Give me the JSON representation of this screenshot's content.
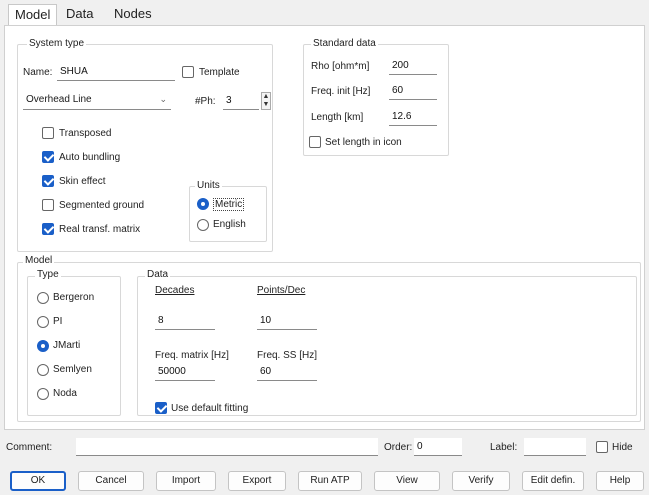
{
  "tabs": [
    "Model",
    "Data",
    "Nodes"
  ],
  "system_type": {
    "label": "System type",
    "name_label": "Name:",
    "name_value": "SHUA",
    "template_label": "Template",
    "template_checked": false,
    "line_type": "Overhead Line",
    "nph_label": "#Ph:",
    "nph_value": "3",
    "checkboxes": [
      {
        "label": "Transposed",
        "checked": false
      },
      {
        "label": "Auto bundling",
        "checked": true
      },
      {
        "label": "Skin effect",
        "checked": true
      },
      {
        "label": "Segmented ground",
        "checked": false
      },
      {
        "label": "Real transf. matrix",
        "checked": true
      }
    ],
    "units": {
      "label": "Units",
      "options": [
        "Metric",
        "English"
      ],
      "selected": "Metric"
    }
  },
  "standard_data": {
    "label": "Standard data",
    "rho_label": "Rho [ohm*m]",
    "rho_value": "200",
    "freq_label": "Freq. init [Hz]",
    "freq_value": "60",
    "length_label": "Length [km]",
    "length_value": "12.6",
    "set_length_label": "Set length in icon",
    "set_length_checked": false
  },
  "model": {
    "label": "Model",
    "type_label": "Type",
    "types": [
      "Bergeron",
      "PI",
      "JMarti",
      "Semlyen",
      "Noda"
    ],
    "selected_type": "JMarti",
    "data_label": "Data",
    "decades_label": "Decades",
    "decades_value": "8",
    "points_label": "Points/Dec",
    "points_value": "10",
    "freq_matrix_label": "Freq. matrix [Hz]",
    "freq_matrix_value": "50000",
    "freq_ss_label": "Freq. SS [Hz]",
    "freq_ss_value": "60",
    "use_default_label": "Use default fitting",
    "use_default_checked": true
  },
  "bottom": {
    "comment_label": "Comment:",
    "comment_value": "",
    "order_label": "Order:",
    "order_value": "0",
    "label_label": "Label:",
    "label_value": "",
    "hide_label": "Hide",
    "hide_checked": false
  },
  "buttons": [
    "OK",
    "Cancel",
    "Import",
    "Export",
    "Run ATP",
    "View",
    "Verify",
    "Edit defin.",
    "Help"
  ],
  "colors": {
    "accent": "#1a5fc8",
    "panel": "#ffffff",
    "window": "#f0f0f0"
  }
}
